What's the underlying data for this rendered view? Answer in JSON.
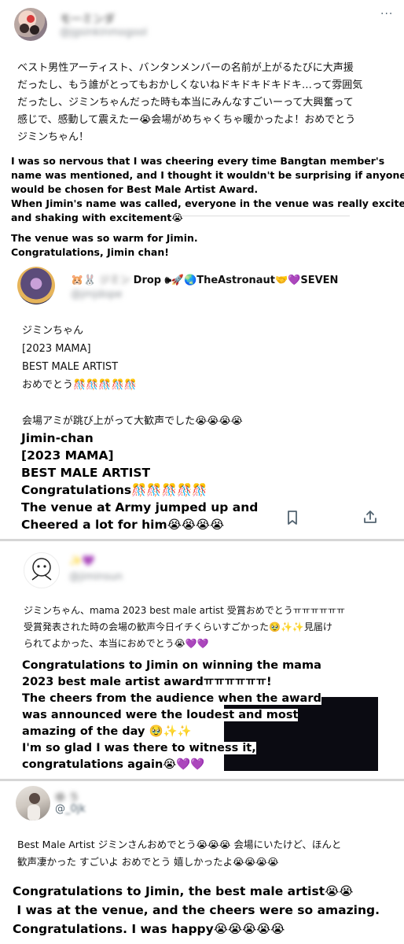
{
  "posts": [
    {
      "handle_blur": "モ一ミンダ",
      "id_blur": "@jgsinkinmogool",
      "jp_lines": [
        "ベスト男性アーティスト、バンタンメンバーの名前が上がるたびに大声援",
        "だったし、もう誰がとってもおかしくないねドキドキドキドキ…って雰囲気",
        "だったし、ジミンちゃんだった時も本当にみんなすごいーって大興奮って",
        "感じで、感動して震えたー😭会場がめちゃくちゃ暖かったよ！おめでとう",
        "ジミンちゃん！"
      ],
      "en_lines": [
        "I was so nervous that I was cheering every time  Bangtan member's",
        "name was mentioned, and I thought it wouldn't be surprising if anyone",
        "would be chosen for Best Male Artist Award.",
        "When Jimin's name was called, everyone in the venue was really excited",
        "and shaking with excitement😭",
        "",
        "The venue was so warm for Jimin.",
        "Congratulations, Jimin chan!"
      ]
    },
    {
      "name_visible": "Drop 🕪🚀🌏TheAstronaut🤝💜SEVEN",
      "name_prefix": "🐹🐰",
      "name_blur": "ジミン",
      "id_blur": "@jmjdope",
      "jp_lines": [
        "ジミンちゃん",
        "[2023 MAMA]",
        "BEST MALE ARTIST",
        "おめでとう🎊🎊🎊🎊🎊",
        "",
        "会場アミが跳び上がって大歓声でした😭😭😭😭"
      ],
      "en_lines": [
        "Jimin-chan",
        "[2023 MAMA]",
        "BEST MALE ARTIST",
        "Congratulations🎊🎊🎊🎊🎊",
        "The venue at Army jumped up and",
        "Cheered a lot for him😭😭😭😭"
      ]
    },
    {
      "name_blur": "✨💜",
      "id_blur": "@jiminsun",
      "jp_lines": [
        "ジミンちゃん、mama 2023 best male artist 受賞おめでとうㅠㅠㅠㅠㅠㅠ",
        "受賞発表された時の会場の歓声今日イチくらいすごかった🥹✨✨見届け",
        "られてよかった、本当におめでとう😭💜💜"
      ],
      "en_lines": [
        "Congratulations to Jimin on winning the mama",
        "2023 best male artist awardㅠㅠㅠㅠㅠㅠ!",
        "The cheers from the audience when the award",
        "was announced were the loudest and most",
        "amazing of the day 🥹✨✨",
        "I'm so glad I was there to witness it,",
        "congratulations again😭💜💜"
      ]
    },
    {
      "name_blur": "ゆ う",
      "id_visible": "@",
      "id_blur": "_0jk",
      "jp_lines": [
        "Best Male Artist ジミンさんおめでとう😭😭😭 会場にいたけど、ほんと",
        "歓声凄かった すごいよ おめでとう 嬉しかったよ😭😭😭😭"
      ],
      "en_lines": [
        "Congratulations to Jimin, the best male artist😭😭",
        " I was at the venue, and the cheers were so amazing.",
        "Congratulations. I was happy😭😭😭😭😭"
      ]
    }
  ],
  "more_icon": "more-dots-icon",
  "colors": {
    "text": "#0f1419",
    "muted": "#536471",
    "separator": "#d6d6d6",
    "redacted": "#0b0b12"
  }
}
